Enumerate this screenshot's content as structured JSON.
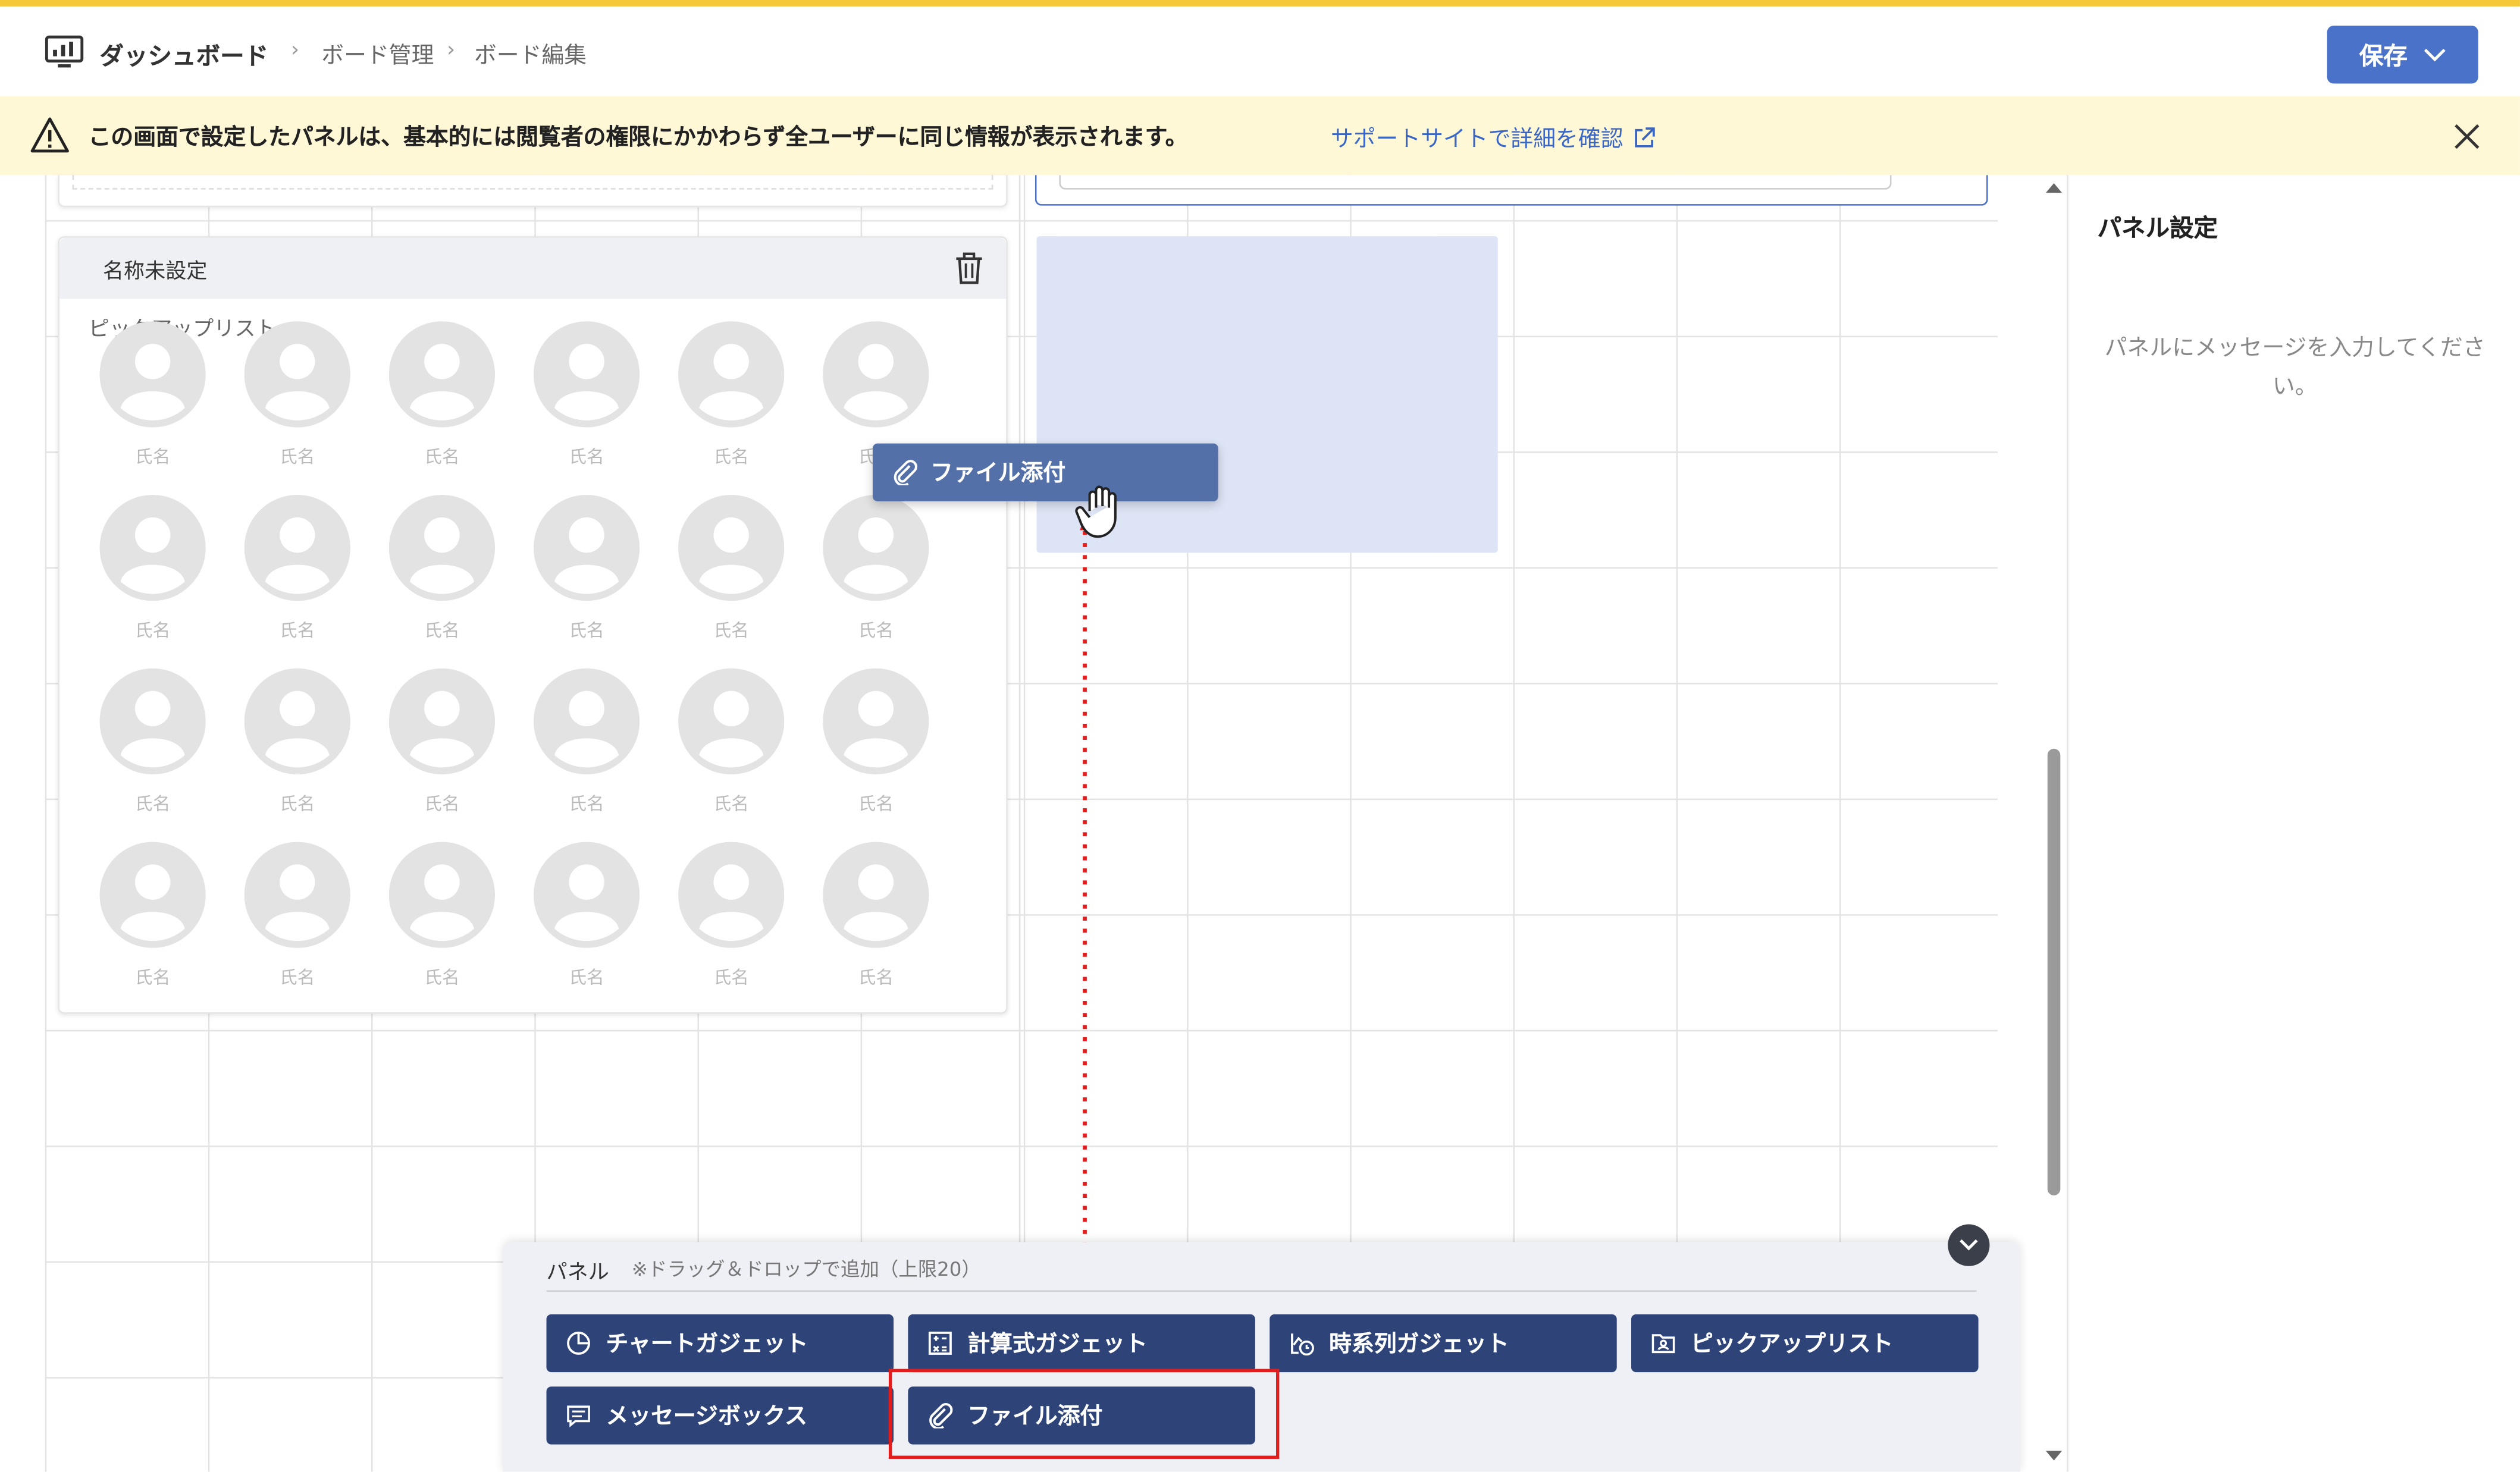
{
  "header": {
    "breadcrumb": [
      "ダッシュボード",
      "ボード管理",
      "ボード編集"
    ],
    "save_label": "保存"
  },
  "notice": {
    "text": "この画面で設定したパネルは、基本的には閲覧者の権限にかかわらず全ユーザーに同じ情報が表示されます。",
    "link": "サポートサイトで詳細を確認"
  },
  "pickup_card": {
    "title": "名称未設定",
    "subtitle": "ピックアップリスト",
    "person_label": "氏名"
  },
  "drag": {
    "chip_label": "ファイル添付"
  },
  "side_panel": {
    "title": "パネル設定",
    "message": "パネルにメッセージを入力してください。"
  },
  "tray": {
    "label": "パネル",
    "hint": "※ドラッグ＆ドロップで追加（上限20）",
    "gadgets": [
      {
        "label": "チャートガジェット",
        "icon": "chart-icon"
      },
      {
        "label": "計算式ガジェット",
        "icon": "calculator-icon"
      },
      {
        "label": "時系列ガジェット",
        "icon": "timeseries-icon"
      },
      {
        "label": "ピックアップリスト",
        "icon": "pickup-icon"
      },
      {
        "label": "メッセージボックス",
        "icon": "message-icon"
      },
      {
        "label": "ファイル添付",
        "icon": "paperclip-icon"
      }
    ]
  },
  "colors": {
    "accent": "#4a72c8",
    "gadget_bg": "#2e4479",
    "notice_bg": "#fff8d6",
    "highlight": "#e01e1e",
    "drop_target": "#dde4f5"
  }
}
